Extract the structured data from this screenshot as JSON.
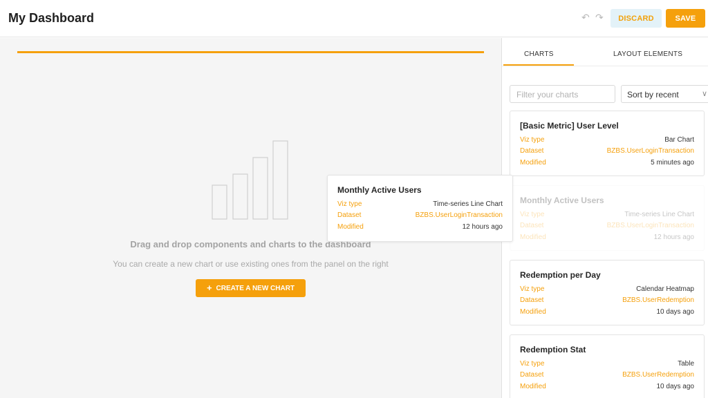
{
  "header": {
    "title": "My Dashboard",
    "discard_label": "DISCARD",
    "save_label": "SAVE",
    "undo_icon": "undo-icon",
    "redo_icon": "redo-icon"
  },
  "canvas": {
    "empty_title": "Drag and drop components and charts to the dashboard",
    "empty_subtitle": "You can create a new chart or use existing ones from the panel on the right",
    "create_label": "CREATE A NEW CHART",
    "empty_icon": "bar-chart-icon"
  },
  "panel": {
    "tabs": [
      {
        "label": "CHARTS",
        "active": true
      },
      {
        "label": "LAYOUT ELEMENTS",
        "active": false
      }
    ],
    "filter_placeholder": "Filter your charts",
    "sort_value": "Sort by recent",
    "field_labels": {
      "viz": "Viz type",
      "dataset": "Dataset",
      "modified": "Modified"
    },
    "charts": [
      {
        "title": "[Basic Metric] User Level",
        "viz": "Bar Chart",
        "dataset": "BZBS.UserLoginTransaction",
        "modified": "5 minutes ago"
      },
      {
        "title": "Monthly Active Users",
        "viz": "Time-series Line Chart",
        "dataset": "BZBS.UserLoginTransaction",
        "modified": "12 hours ago"
      },
      {
        "title": "Redemption per Day",
        "viz": "Calendar Heatmap",
        "dataset": "BZBS.UserRedemption",
        "modified": "10 days ago"
      },
      {
        "title": "Redemption Stat",
        "viz": "Table",
        "dataset": "BZBS.UserRedemption",
        "modified": "10 days ago"
      }
    ]
  },
  "drag_preview": {
    "title": "Monthly Active Users",
    "viz": "Time-series Line Chart",
    "dataset": "BZBS.UserLoginTransaction",
    "modified": "12 hours ago"
  },
  "colors": {
    "accent": "#f5a00c",
    "discard_bg": "#e3f2f8",
    "canvas_bg": "#f5f5f5"
  }
}
